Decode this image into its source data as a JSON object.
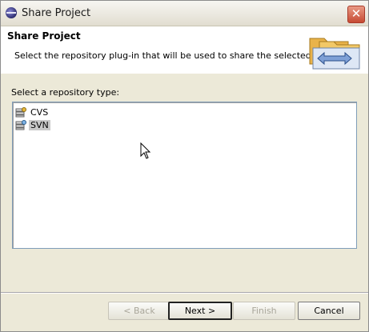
{
  "window": {
    "title": "Share Project"
  },
  "header": {
    "title": "Share Project",
    "description": "Select the repository plug-in that will be used to share the selected project."
  },
  "list": {
    "label": "Select a repository type:",
    "items": [
      {
        "label": "CVS",
        "selected": false
      },
      {
        "label": "SVN",
        "selected": true
      }
    ]
  },
  "buttons": {
    "back": "< Back",
    "next": "Next >",
    "finish": "Finish",
    "cancel": "Cancel"
  }
}
